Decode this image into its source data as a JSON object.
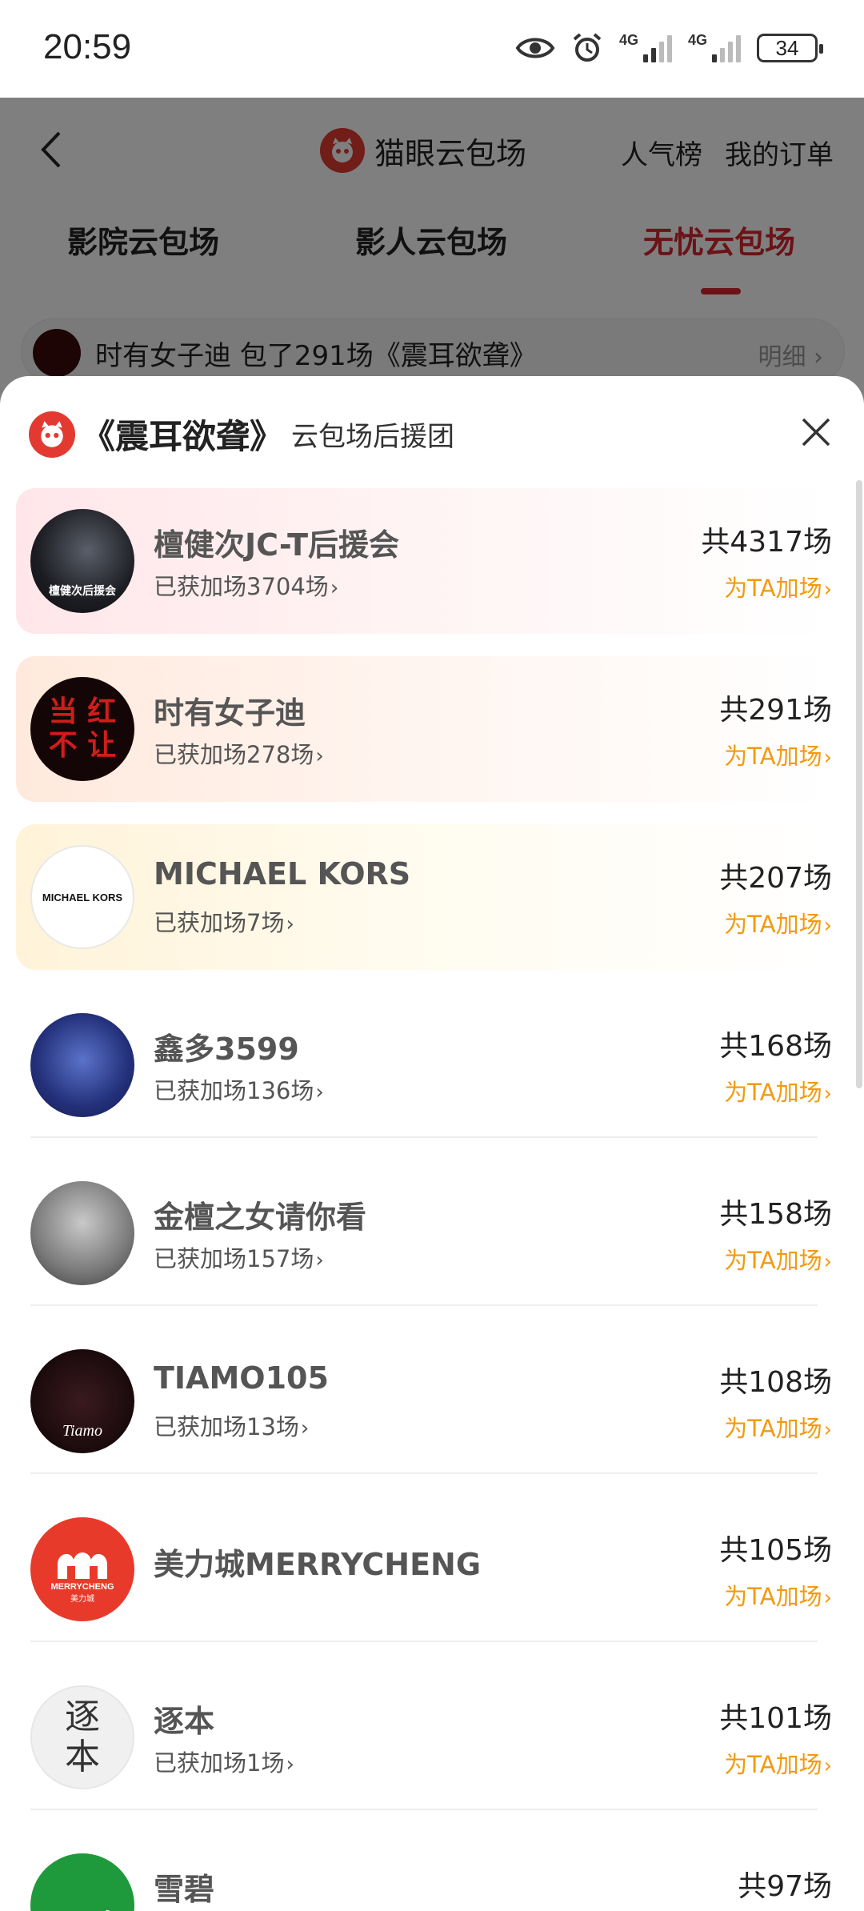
{
  "status_bar": {
    "time": "20:59",
    "battery": "34",
    "net1": "4G",
    "net2": "4G"
  },
  "nav": {
    "title": "猫眼云包场",
    "links": [
      "人气榜",
      "我的订单"
    ]
  },
  "tabs": [
    {
      "label": "影院云包场"
    },
    {
      "label": "影人云包场"
    },
    {
      "label": "无忧云包场"
    }
  ],
  "ticker": {
    "text": "时有女子迪 包了291场《震耳欲聋》",
    "detail": "明细"
  },
  "sheet": {
    "movie": "《震耳欲聋》",
    "subtitle": "云包场后援团",
    "items": [
      {
        "name": "檀健次JC-T后援会",
        "boosted": "已获加场3704场",
        "total": "共4317场",
        "cta": "为TA加场",
        "avatar_text": "檀健次后援会"
      },
      {
        "name": "时有女子迪",
        "boosted": "已获加场278场",
        "total": "共291场",
        "cta": "为TA加场",
        "avatar_text": "当 红 不 让"
      },
      {
        "name": "MICHAEL KORS",
        "boosted": "已获加场7场",
        "total": "共207场",
        "cta": "为TA加场",
        "avatar_text": "MICHAEL KORS"
      },
      {
        "name": "鑫多3599",
        "boosted": "已获加场136场",
        "total": "共168场",
        "cta": "为TA加场"
      },
      {
        "name": "金檀之女请你看",
        "boosted": "已获加场157场",
        "total": "共158场",
        "cta": "为TA加场"
      },
      {
        "name": "TIAMO105",
        "boosted": "已获加场13场",
        "total": "共108场",
        "cta": "为TA加场",
        "avatar_text": "Tiamo"
      },
      {
        "name": "美力城MERRYCHENG",
        "boosted": "",
        "total": "共105场",
        "cta": "为TA加场",
        "avatar_text": "MERRYCHENG",
        "avatar_sub": "美力城"
      },
      {
        "name": "逐本",
        "boosted": "已获加场1场",
        "total": "共101场",
        "cta": "为TA加场",
        "avatar_text": "逐本"
      },
      {
        "name": "雪碧",
        "boosted": "",
        "total": "共97场",
        "cta": "",
        "avatar_text": "雪碧"
      }
    ]
  }
}
